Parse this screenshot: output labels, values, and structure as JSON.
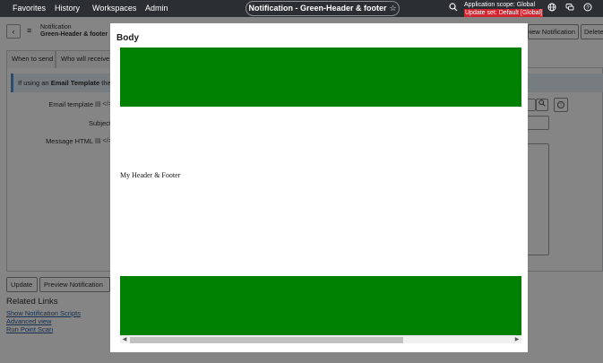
{
  "nav": {
    "items": [
      "Favorites",
      "History",
      "Workspaces",
      "Admin"
    ],
    "title": "Notification - Green-Header & footer",
    "star": "☆",
    "scope": "Application scope: Global",
    "update_set": "Update set: Default [Global]",
    "icons": [
      "search-icon",
      "globe-icon",
      "chat-icon",
      "help-icon"
    ]
  },
  "record": {
    "back": "‹",
    "menu": "≡",
    "type": "Notification",
    "name": "Green-Header & footer",
    "header_buttons": [
      "Preview Notification",
      "Delete"
    ]
  },
  "tabs": [
    "When to send",
    "Who will receive"
  ],
  "banner": {
    "prefix": "If using an ",
    "bold": "Email Template",
    "suffix": " then S"
  },
  "form": {
    "labels": [
      "Email template",
      "Subject",
      "Message HTML"
    ],
    "field_icon": "▤ </>"
  },
  "bottom_buttons": [
    "Update",
    "Preview Notification"
  ],
  "related": {
    "title": "Related Links",
    "links": [
      "Show Notification Scripts",
      "Advanced view",
      "Run Point Scan"
    ]
  },
  "modal": {
    "title": "Body",
    "preview_text": "My Header & Footer",
    "header_color": "#008000",
    "footer_color": "#008000"
  },
  "colors": {
    "nav_bg": "#2b2e33",
    "update_set_bg": "#d1242f",
    "link": "#2d5b9a"
  }
}
